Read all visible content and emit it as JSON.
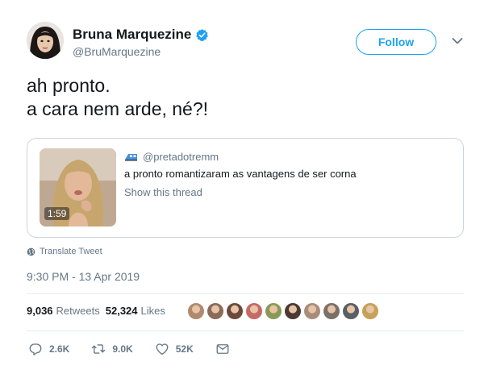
{
  "user": {
    "display_name": "Bruna Marquezine",
    "handle": "@BruMarquezine",
    "verified": true
  },
  "follow_label": "Follow",
  "tweet": {
    "lines": [
      "ah pronto.",
      "a cara nem arde, né?!"
    ]
  },
  "quote": {
    "handle": "@pretadotremm",
    "text": "a pronto romantizaram as vantagens de ser corna",
    "show_thread": "Show this thread",
    "video_duration": "1:59"
  },
  "translate_label": "Translate Tweet",
  "timestamp": "9:30 PM - 13 Apr 2019",
  "stats": {
    "retweets": "9,036",
    "retweets_label": "Retweets",
    "likes": "52,324",
    "likes_label": "Likes"
  },
  "liker_avatar_colors": [
    "#b08a6e",
    "#8a6a58",
    "#6b4a3b",
    "#c56b66",
    "#8a9a56",
    "#4a3a33",
    "#a98d7a",
    "#7a7068",
    "#5a5f66",
    "#c7a05a"
  ],
  "actions": {
    "replies": "2.6K",
    "retweets": "9.0K",
    "likes": "52K"
  },
  "colors": {
    "accent": "#1da1f2",
    "muted": "#657786",
    "border": "#ccd6dd",
    "text": "#14171a"
  }
}
